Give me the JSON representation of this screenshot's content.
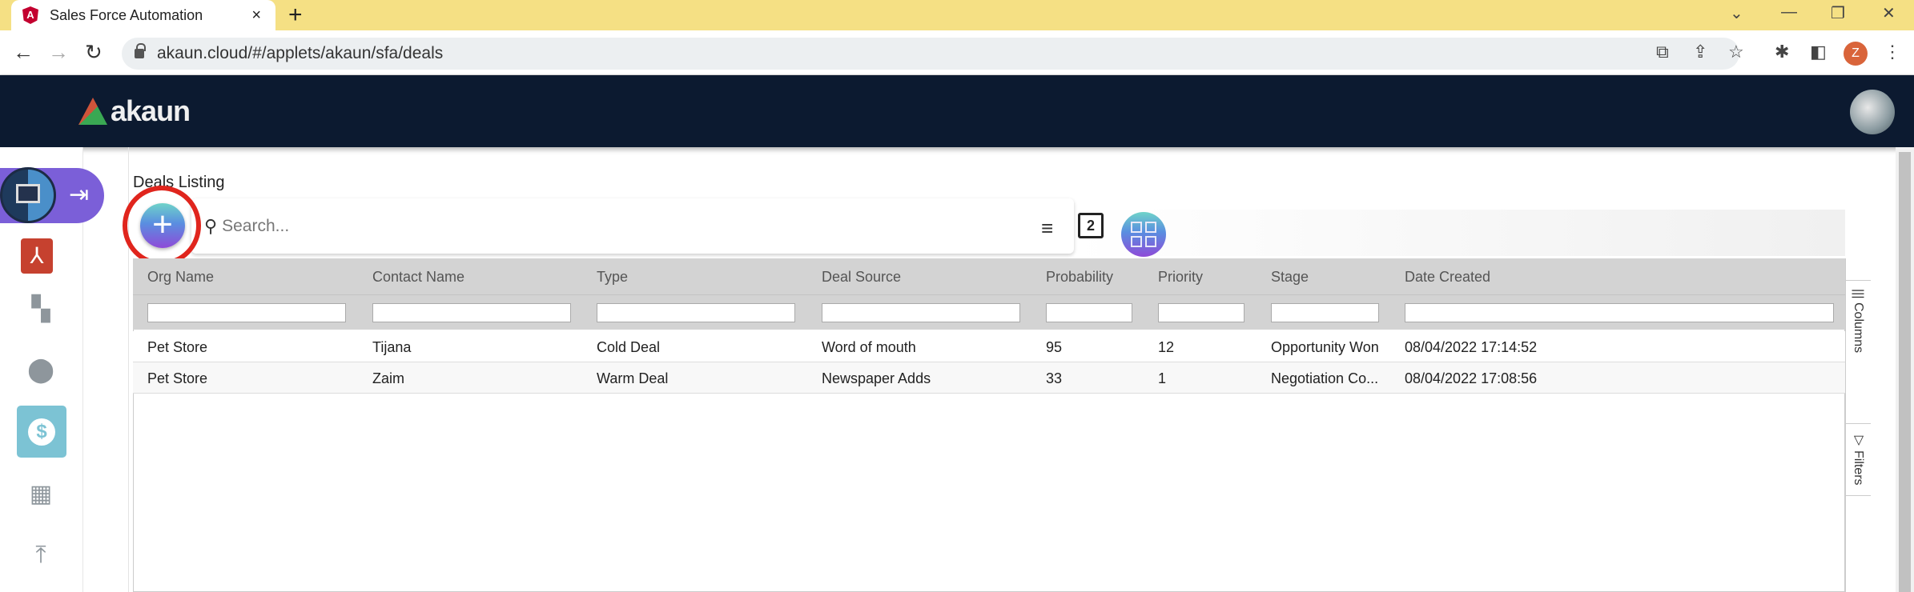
{
  "browser": {
    "tab_title": "Sales Force Automation",
    "tab_close": "×",
    "new_tab": "+",
    "url": "akaun.cloud/#/applets/akaun/sfa/deals",
    "profile_initial": "Z",
    "window_controls": [
      "⌄",
      "—",
      "❐",
      "✕"
    ]
  },
  "app": {
    "logo_text": "akaun"
  },
  "sidebar": {
    "items": [
      {
        "icon": "sfa-app-icon",
        "active": true
      },
      {
        "icon": "acrobat-icon"
      },
      {
        "icon": "dashboard-icon"
      },
      {
        "icon": "contacts-icon"
      },
      {
        "icon": "dollar-icon",
        "selected": true
      },
      {
        "icon": "organization-icon"
      },
      {
        "icon": "upload-icon"
      }
    ]
  },
  "page": {
    "title": "Deals Listing",
    "search_placeholder": "Search...",
    "add_button": "+",
    "copy_badge": "2",
    "highlight_color": "#e0251d"
  },
  "grid": {
    "columns": [
      "Org Name",
      "Contact Name",
      "Type",
      "Deal Source",
      "Probability",
      "Priority",
      "Stage",
      "Date Created"
    ],
    "rows": [
      [
        "Pet Store",
        "Tijana",
        "Cold Deal",
        "Word of mouth",
        "95",
        "12",
        "Opportunity Won",
        "08/04/2022 17:14:52"
      ],
      [
        "Pet Store",
        "Zaim",
        "Warm Deal",
        "Newspaper Adds",
        "33",
        "1",
        "Negotiation Co...",
        "08/04/2022 17:08:56"
      ]
    ],
    "side_tabs": {
      "columns": "Columns",
      "filters": "Filters"
    }
  }
}
